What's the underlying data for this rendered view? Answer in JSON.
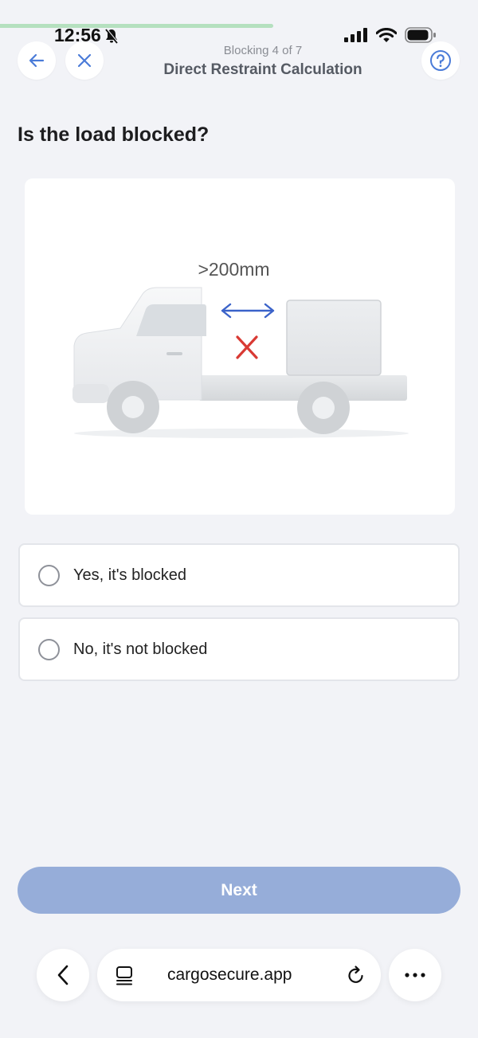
{
  "status_bar": {
    "time": "12:56"
  },
  "progress": {
    "fraction": 0.571
  },
  "header": {
    "subtitle": "Blocking 4 of 7",
    "title": "Direct Restraint Calculation"
  },
  "question": "Is the load blocked?",
  "illustration": {
    "measurement_label": ">200mm"
  },
  "options": [
    {
      "label": "Yes, it's blocked"
    },
    {
      "label": "No, it's not blocked"
    }
  ],
  "next_button": {
    "label": "Next"
  },
  "browser": {
    "url": "cargosecure.app"
  },
  "colors": {
    "accent": "#4a7bd8",
    "next_disabled": "#96add9",
    "progress": "#b5e0bf",
    "cross": "#d93a34"
  }
}
